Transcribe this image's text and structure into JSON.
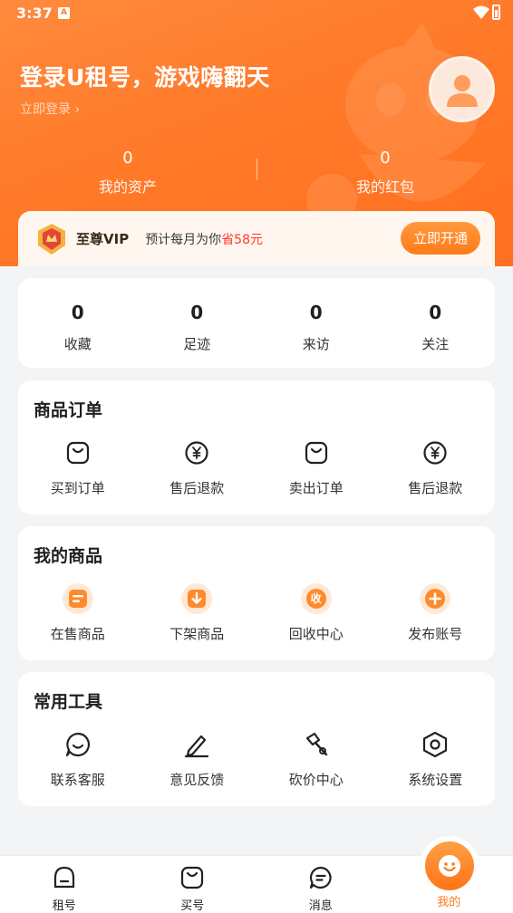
{
  "status_bar": {
    "time": "3:37",
    "notif_letter": "A"
  },
  "header": {
    "login_title": "登录U租号，游戏嗨翻天",
    "login_link": "立即登录 ›"
  },
  "assets": [
    {
      "value": "0",
      "label": "我的资产"
    },
    {
      "value": "0",
      "label": "我的红包"
    }
  ],
  "vip": {
    "title": "至尊VIP",
    "desc": "预计每月为你",
    "save": "省58元",
    "button": "立即开通"
  },
  "stats": [
    {
      "value": "0",
      "label": "收藏"
    },
    {
      "value": "0",
      "label": "足迹"
    },
    {
      "value": "0",
      "label": "来访"
    },
    {
      "value": "0",
      "label": "关注"
    }
  ],
  "orders": {
    "title": "商品订单",
    "items": [
      {
        "label": "买到订单",
        "icon": "bag-icon"
      },
      {
        "label": "售后退款",
        "icon": "yen-icon"
      },
      {
        "label": "卖出订单",
        "icon": "bag-icon"
      },
      {
        "label": "售后退款",
        "icon": "yen-icon"
      }
    ]
  },
  "goods": {
    "title": "我的商品",
    "items": [
      {
        "label": "在售商品",
        "icon": "list-icon"
      },
      {
        "label": "下架商品",
        "icon": "download-icon"
      },
      {
        "label": "回收中心",
        "icon": "recycle-icon",
        "glyph": "收"
      },
      {
        "label": "发布账号",
        "icon": "plus-icon"
      }
    ]
  },
  "tools": {
    "title": "常用工具",
    "items": [
      {
        "label": "联系客服",
        "icon": "chat-icon"
      },
      {
        "label": "意见反馈",
        "icon": "pen-icon"
      },
      {
        "label": "砍价中心",
        "icon": "axe-icon"
      },
      {
        "label": "系统设置",
        "icon": "hexagon-settings-icon"
      }
    ]
  },
  "tabbar": [
    {
      "label": "租号",
      "icon": "rent-icon"
    },
    {
      "label": "买号",
      "icon": "buy-icon"
    },
    {
      "label": "消息",
      "icon": "message-icon"
    },
    {
      "label": "我的",
      "icon": "mine-icon",
      "active": true
    }
  ],
  "colors": {
    "accent": "#ff7a29",
    "vip_save": "#ff3b2f",
    "page_bg": "#f3f4f6"
  }
}
